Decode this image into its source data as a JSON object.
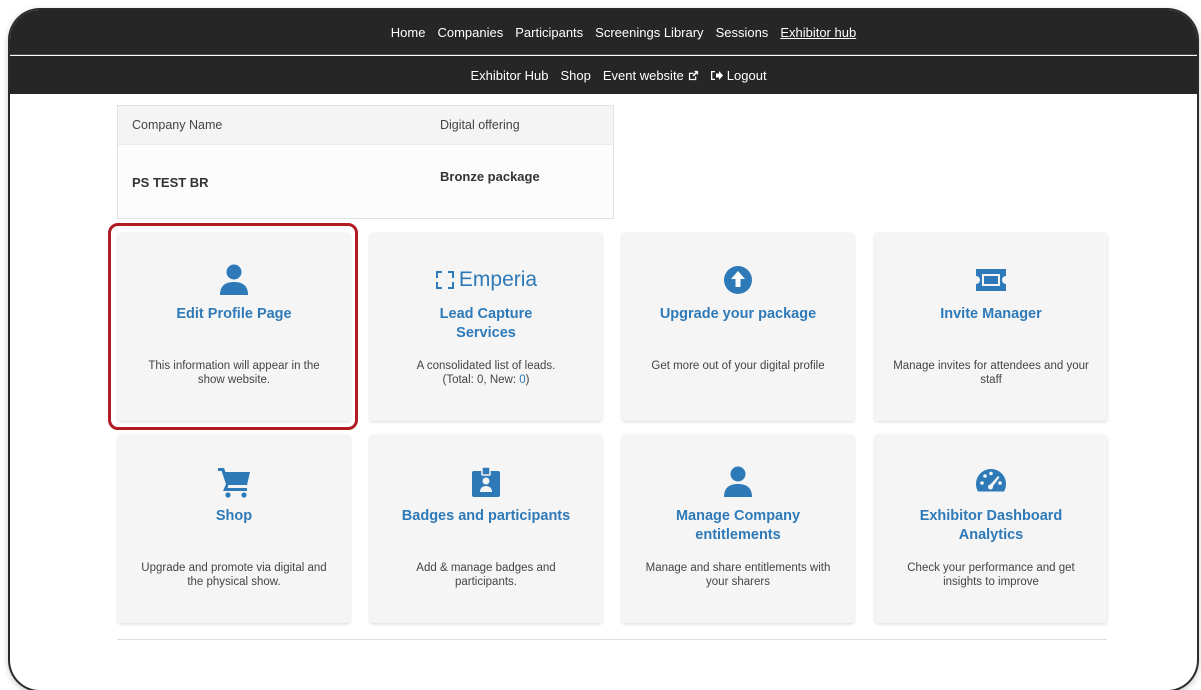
{
  "nav_primary": [
    {
      "label": "Home",
      "active": false
    },
    {
      "label": "Companies",
      "active": false
    },
    {
      "label": "Participants",
      "active": false
    },
    {
      "label": "Screenings Library",
      "active": false
    },
    {
      "label": "Sessions",
      "active": false
    },
    {
      "label": "Exhibitor hub",
      "active": true
    }
  ],
  "nav_secondary": {
    "hub": "Exhibitor Hub",
    "shop": "Shop",
    "event_website": "Event website",
    "logout": "Logout"
  },
  "company_table": {
    "headers": [
      "Company Name",
      "Digital offering"
    ],
    "row": [
      "PS TEST BR",
      "Bronze package"
    ]
  },
  "cards": [
    {
      "title": "Edit Profile Page",
      "desc": "This information will appear in the show website.",
      "icon": "user-icon"
    },
    {
      "logo_text": "Emperia",
      "title": "Lead Capture Services",
      "desc_line1": "A consolidated list of leads.",
      "desc_pre": "(Total: 0, New: ",
      "desc_new": "0",
      "desc_post": ")"
    },
    {
      "title": "Upgrade your package",
      "desc": "Get more out of your digital profile",
      "icon": "arrow-up-circle-icon"
    },
    {
      "title": "Invite Manager",
      "desc": "Manage invites for attendees and your staff",
      "icon": "ticket-icon"
    },
    {
      "title": "Shop",
      "desc": "Upgrade and promote via digital and the physical show.",
      "icon": "cart-icon"
    },
    {
      "title": "Badges and participants",
      "desc": "Add & manage badges and participants.",
      "icon": "badge-icon"
    },
    {
      "title": "Manage Company entitlements",
      "desc": "Manage and share entitlements with your sharers",
      "icon": "user-icon"
    },
    {
      "title": "Exhibitor Dashboard Analytics",
      "desc": "Check your performance and get insights to improve",
      "icon": "dashboard-icon"
    }
  ],
  "colors": {
    "accent": "#2e7ab8",
    "nav_bg": "#262626",
    "highlight": "#b01c22"
  }
}
